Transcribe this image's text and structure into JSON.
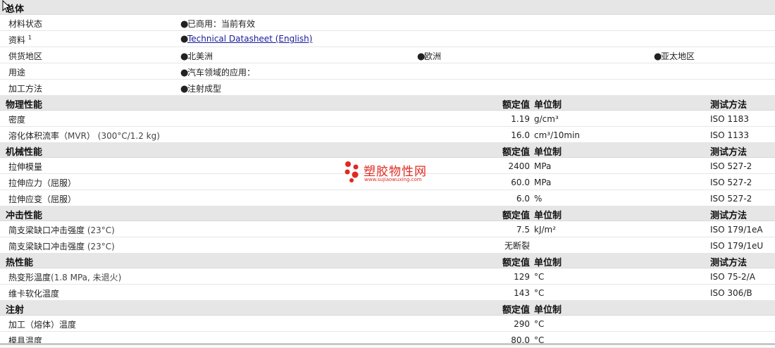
{
  "general": {
    "title": "总体",
    "rows": [
      {
        "label": "材料状态",
        "items": [
          "已商用：当前有效"
        ]
      },
      {
        "label": "资料",
        "sup": "1",
        "items": [
          "Technical Datasheet (English)"
        ]
      },
      {
        "label": "供货地区",
        "items": [
          "北美洲",
          "欧洲",
          "亚太地区"
        ]
      },
      {
        "label": "用途",
        "items": [
          "汽车领域的应用："
        ]
      },
      {
        "label": "加工方法",
        "items": [
          "注射成型"
        ]
      }
    ]
  },
  "columns": {
    "value": "额定值",
    "unit": "单位制",
    "test": "测试方法"
  },
  "sections": [
    {
      "title": "物理性能",
      "rows": [
        {
          "label": "密度",
          "value": "1.19",
          "unit": "g/cm³",
          "test": "ISO 1183"
        },
        {
          "label": "溶化体积流率（",
          "label_abbr": "MVR",
          "label_tail": "）",
          "label_cond": "(300°C/1.2 kg)",
          "value": "16.0",
          "unit": "cm³/10min",
          "test": "ISO 1133"
        }
      ]
    },
    {
      "title": "机械性能",
      "rows": [
        {
          "label": "拉伸模量",
          "value": "2400",
          "unit": "MPa",
          "test": "ISO 527-2"
        },
        {
          "label": "拉伸应力（屈服）",
          "value": "60.0",
          "unit": "MPa",
          "test": "ISO 527-2"
        },
        {
          "label": "拉伸应变（屈服）",
          "value": "6.0",
          "unit": "%",
          "test": "ISO 527-2"
        }
      ]
    },
    {
      "title": "冲击性能",
      "rows": [
        {
          "label": "简支梁缺口冲击强度",
          "label_cond": "(23°C)",
          "value": "7.5",
          "unit": "kJ/m²",
          "test": "ISO 179/1eA"
        },
        {
          "label": "简支梁缺口冲击强度",
          "label_cond": "(23°C)",
          "value": "无断裂",
          "unit": "",
          "test": "ISO 179/1eU"
        }
      ]
    },
    {
      "title": "热性能",
      "rows": [
        {
          "label": "热变形温度",
          "label_cond": "(1.8 MPa, 未退火)",
          "value": "129",
          "unit": "°C",
          "test": "ISO 75-2/A"
        },
        {
          "label": "维卡软化温度",
          "value": "143",
          "unit": "°C",
          "test": "ISO 306/B"
        }
      ]
    },
    {
      "title": "注射",
      "rows": [
        {
          "label": "加工（熔体）温度",
          "value": "290",
          "unit": "°C",
          "test": ""
        },
        {
          "label": "模具温度",
          "value": "80.0",
          "unit": "°C",
          "test": ""
        }
      ]
    }
  ],
  "watermark": {
    "title": "塑胶物性网",
    "url": "www.sujiaowuxing.com",
    "color": "#e02a20"
  },
  "icons": {
    "bullet": "bullet-dot",
    "cursor": "mouse-pointer-icon"
  }
}
